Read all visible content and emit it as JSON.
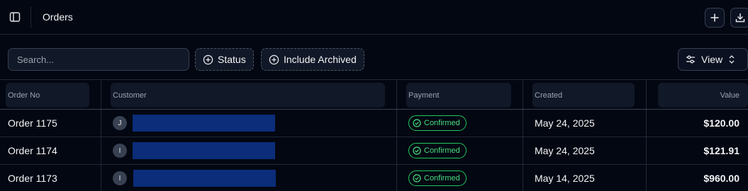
{
  "header": {
    "title": "Orders",
    "icons": {
      "sidebar": "sidebar-toggle-icon",
      "add": "plus-icon",
      "download": "download-icon"
    }
  },
  "toolbar": {
    "search_placeholder": "Search...",
    "status_label": "Status",
    "archived_label": "Include Archived",
    "view_label": "View"
  },
  "table": {
    "columns": [
      "Order No",
      "Customer",
      "Payment",
      "Created",
      "Value"
    ],
    "rows": [
      {
        "order_no": "Order 1175",
        "avatar": "J",
        "payment": "Confirmed",
        "created": "May 24, 2025",
        "value": "$120.00"
      },
      {
        "order_no": "Order 1174",
        "avatar": "I",
        "payment": "Confirmed",
        "created": "May 24, 2025",
        "value": "$121.91"
      },
      {
        "order_no": "Order 1173",
        "avatar": "I",
        "payment": "Confirmed",
        "created": "May 14, 2025",
        "value": "$960.00"
      }
    ]
  },
  "colors": {
    "background": "#030712",
    "success": "#22c55e",
    "redaction": "#0b2d7a"
  }
}
